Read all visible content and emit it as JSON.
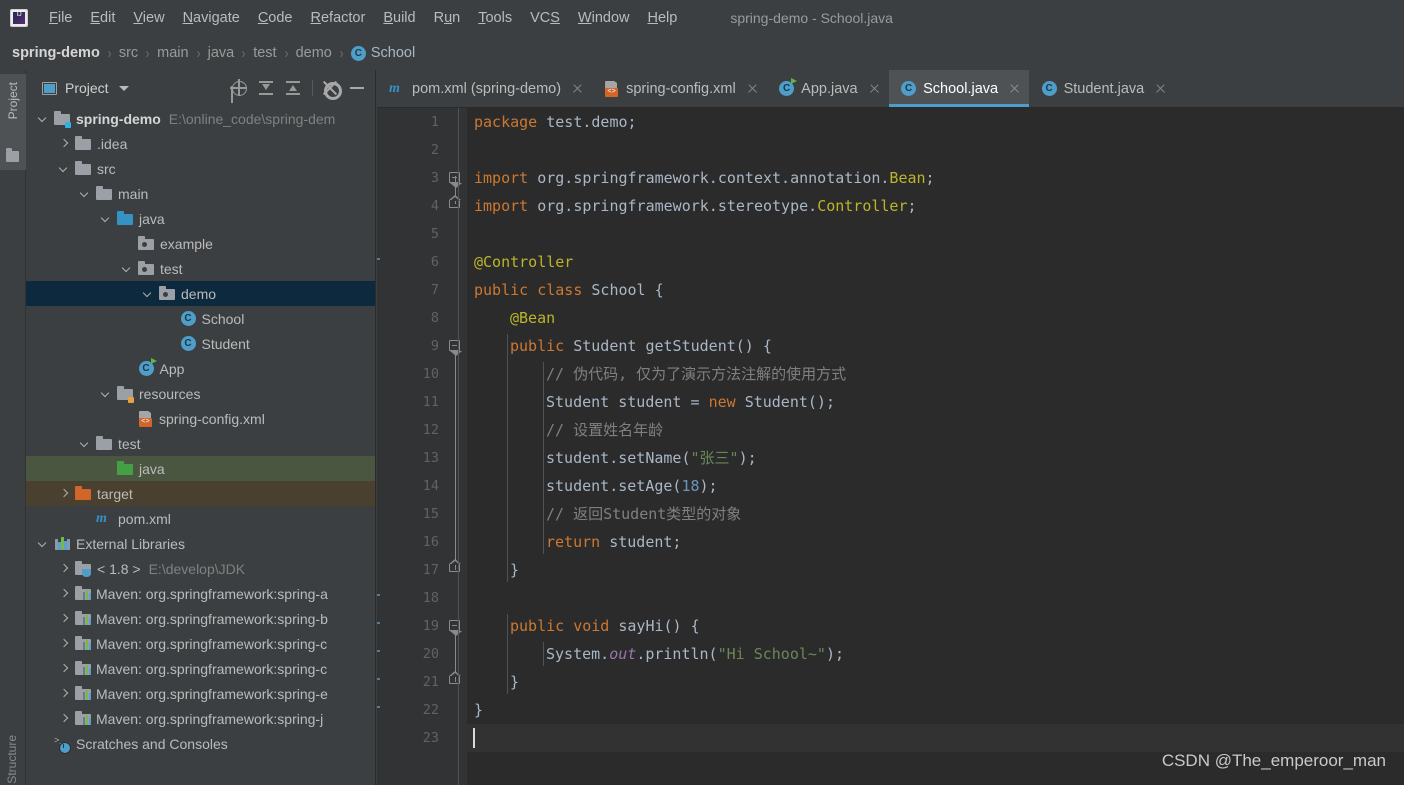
{
  "window": {
    "title": "spring-demo - School.java",
    "logo_icon": "intellij-idea-logo"
  },
  "menu": {
    "items": [
      {
        "label": "File",
        "mnemonic": "F"
      },
      {
        "label": "Edit",
        "mnemonic": "E"
      },
      {
        "label": "View",
        "mnemonic": "V"
      },
      {
        "label": "Navigate",
        "mnemonic": "N"
      },
      {
        "label": "Code",
        "mnemonic": "C"
      },
      {
        "label": "Refactor",
        "mnemonic": "R"
      },
      {
        "label": "Build",
        "mnemonic": "B"
      },
      {
        "label": "Run",
        "mnemonic": "u"
      },
      {
        "label": "Tools",
        "mnemonic": "T"
      },
      {
        "label": "VCS",
        "mnemonic": "S"
      },
      {
        "label": "Window",
        "mnemonic": "W"
      },
      {
        "label": "Help",
        "mnemonic": "H"
      }
    ]
  },
  "breadcrumb": {
    "separator": "›",
    "items": [
      {
        "label": "spring-demo",
        "style": "root"
      },
      {
        "label": "src",
        "style": "dim"
      },
      {
        "label": "main",
        "style": "dim"
      },
      {
        "label": "java",
        "style": "dim"
      },
      {
        "label": "test",
        "style": "dim"
      },
      {
        "label": "demo",
        "style": "dim"
      },
      {
        "label": "School",
        "style": "class",
        "icon": "class-icon",
        "badge": "C"
      }
    ]
  },
  "left_strip": {
    "project_label": "Project",
    "structure_label": "Structure"
  },
  "project_panel": {
    "title": "Project",
    "dropdown_icon": "chevron-down-icon",
    "toolbar": [
      {
        "name": "locate-icon",
        "tooltip": "Select Opened File"
      },
      {
        "name": "expand-all-icon",
        "tooltip": "Expand All"
      },
      {
        "name": "collapse-all-icon",
        "tooltip": "Collapse All"
      },
      {
        "name": "gear-icon",
        "tooltip": "Settings"
      },
      {
        "name": "minimize-icon",
        "tooltip": "Hide"
      }
    ],
    "tree": [
      {
        "label": "spring-demo",
        "path": "E:\\online_code\\spring-dem",
        "indent": 0,
        "arrow": "down",
        "icon": "module-folder",
        "bold": true,
        "state": "normal"
      },
      {
        "label": ".idea",
        "path": "",
        "indent": 1,
        "arrow": "right",
        "icon": "folder-grey",
        "bold": false,
        "state": "normal"
      },
      {
        "label": "src",
        "path": "",
        "indent": 1,
        "arrow": "down",
        "icon": "folder-grey",
        "bold": false,
        "state": "normal"
      },
      {
        "label": "main",
        "path": "",
        "indent": 2,
        "arrow": "down",
        "icon": "folder-grey",
        "bold": false,
        "state": "normal"
      },
      {
        "label": "java",
        "path": "",
        "indent": 3,
        "arrow": "down",
        "icon": "folder-blue",
        "bold": false,
        "state": "normal"
      },
      {
        "label": "example",
        "path": "",
        "indent": 4,
        "arrow": "none",
        "icon": "folder-package",
        "bold": false,
        "state": "normal"
      },
      {
        "label": "test",
        "path": "",
        "indent": 4,
        "arrow": "down",
        "icon": "folder-package",
        "bold": false,
        "state": "normal"
      },
      {
        "label": "demo",
        "path": "",
        "indent": 5,
        "arrow": "down",
        "icon": "folder-package",
        "bold": false,
        "state": "selected"
      },
      {
        "label": "School",
        "path": "",
        "indent": 6,
        "arrow": "none",
        "icon": "class-icon",
        "bold": false,
        "state": "normal"
      },
      {
        "label": "Student",
        "path": "",
        "indent": 6,
        "arrow": "none",
        "icon": "class-icon",
        "bold": false,
        "state": "normal"
      },
      {
        "label": "App",
        "path": "",
        "indent": 4,
        "arrow": "none",
        "icon": "class-runnable-icon",
        "bold": false,
        "state": "normal"
      },
      {
        "label": "resources",
        "path": "",
        "indent": 3,
        "arrow": "down",
        "icon": "folder-resources",
        "bold": false,
        "state": "normal"
      },
      {
        "label": "spring-config.xml",
        "path": "",
        "indent": 4,
        "arrow": "none",
        "icon": "xml-file-icon",
        "bold": false,
        "state": "normal"
      },
      {
        "label": "test",
        "path": "",
        "indent": 2,
        "arrow": "down",
        "icon": "folder-grey",
        "bold": false,
        "state": "normal"
      },
      {
        "label": "java",
        "path": "",
        "indent": 3,
        "arrow": "none",
        "icon": "folder-green",
        "bold": false,
        "state": "highlight-green"
      },
      {
        "label": "target",
        "path": "",
        "indent": 1,
        "arrow": "right",
        "icon": "folder-orange",
        "bold": false,
        "state": "highlight-brown"
      },
      {
        "label": "pom.xml",
        "path": "",
        "indent": 2,
        "arrow": "none",
        "icon": "maven-icon",
        "bold": false,
        "state": "normal"
      },
      {
        "label": "External Libraries",
        "path": "",
        "indent": 0,
        "arrow": "down",
        "icon": "libraries-icon",
        "bold": false,
        "state": "normal"
      },
      {
        "label": "< 1.8 >",
        "path": "E:\\develop\\JDK",
        "indent": 1,
        "arrow": "right",
        "icon": "jdk-icon",
        "bold": false,
        "state": "normal"
      },
      {
        "label": "Maven: org.springframework:spring-a",
        "path": "",
        "indent": 1,
        "arrow": "right",
        "icon": "maven-lib-icon",
        "bold": false,
        "state": "normal"
      },
      {
        "label": "Maven: org.springframework:spring-b",
        "path": "",
        "indent": 1,
        "arrow": "right",
        "icon": "maven-lib-icon",
        "bold": false,
        "state": "normal"
      },
      {
        "label": "Maven: org.springframework:spring-c",
        "path": "",
        "indent": 1,
        "arrow": "right",
        "icon": "maven-lib-icon",
        "bold": false,
        "state": "normal"
      },
      {
        "label": "Maven: org.springframework:spring-c",
        "path": "",
        "indent": 1,
        "arrow": "right",
        "icon": "maven-lib-icon",
        "bold": false,
        "state": "normal"
      },
      {
        "label": "Maven: org.springframework:spring-e",
        "path": "",
        "indent": 1,
        "arrow": "right",
        "icon": "maven-lib-icon",
        "bold": false,
        "state": "normal"
      },
      {
        "label": "Maven: org.springframework:spring-j",
        "path": "",
        "indent": 1,
        "arrow": "right",
        "icon": "maven-lib-icon",
        "bold": false,
        "state": "normal"
      },
      {
        "label": "Scratches and Consoles",
        "path": "",
        "indent": 0,
        "arrow": "none",
        "icon": "scratches-icon",
        "bold": false,
        "state": "normal"
      }
    ]
  },
  "editor": {
    "tabs": [
      {
        "label": "pom.xml (spring-demo)",
        "icon": "maven-icon",
        "active": false
      },
      {
        "label": "spring-config.xml",
        "icon": "xml-file-icon",
        "active": false
      },
      {
        "label": "App.java",
        "icon": "class-runnable-icon",
        "active": false
      },
      {
        "label": "School.java",
        "icon": "class-icon",
        "active": true
      },
      {
        "label": "Student.java",
        "icon": "class-icon",
        "active": false
      }
    ],
    "active_tab": "School.java",
    "caret_line": 23,
    "line_numbers": [
      1,
      2,
      3,
      4,
      5,
      6,
      7,
      8,
      9,
      10,
      11,
      12,
      13,
      14,
      15,
      16,
      17,
      18,
      19,
      20,
      21,
      22,
      23
    ],
    "code_lines": [
      {
        "n": 1,
        "indent": 0,
        "tokens": [
          {
            "t": "package ",
            "c": "kw"
          },
          {
            "t": "test.demo;",
            "c": "pun"
          }
        ]
      },
      {
        "n": 2,
        "indent": 0,
        "tokens": []
      },
      {
        "n": 3,
        "indent": 0,
        "tokens": [
          {
            "t": "import ",
            "c": "kw"
          },
          {
            "t": "org.springframework.context.annotation.",
            "c": "pun"
          },
          {
            "t": "Bean",
            "c": "ann"
          },
          {
            "t": ";",
            "c": "pun"
          }
        ]
      },
      {
        "n": 4,
        "indent": 0,
        "tokens": [
          {
            "t": "import ",
            "c": "kw"
          },
          {
            "t": "org.springframework.stereotype.",
            "c": "pun"
          },
          {
            "t": "Controller",
            "c": "ann"
          },
          {
            "t": ";",
            "c": "pun"
          }
        ]
      },
      {
        "n": 5,
        "indent": 0,
        "tokens": []
      },
      {
        "n": 6,
        "indent": 0,
        "tokens": [
          {
            "t": "@Controller",
            "c": "ann"
          }
        ]
      },
      {
        "n": 7,
        "indent": 0,
        "tokens": [
          {
            "t": "public class ",
            "c": "kw"
          },
          {
            "t": "School",
            "c": "cls"
          },
          {
            "t": " {",
            "c": "pun"
          }
        ]
      },
      {
        "n": 8,
        "indent": 1,
        "tokens": [
          {
            "t": "@Bean",
            "c": "ann"
          }
        ]
      },
      {
        "n": 9,
        "indent": 1,
        "tokens": [
          {
            "t": "public ",
            "c": "kw"
          },
          {
            "t": "Student",
            "c": "typ"
          },
          {
            "t": " ",
            "c": "pun"
          },
          {
            "t": "getStudent",
            "c": "dim"
          },
          {
            "t": "() {",
            "c": "pun"
          }
        ]
      },
      {
        "n": 10,
        "indent": 2,
        "tokens": [
          {
            "t": "// 伪代码, 仅为了演示方法注解的使用方式",
            "c": "cmt"
          }
        ]
      },
      {
        "n": 11,
        "indent": 2,
        "tokens": [
          {
            "t": "Student",
            "c": "typ"
          },
          {
            "t": " student = ",
            "c": "pun"
          },
          {
            "t": "new ",
            "c": "kw"
          },
          {
            "t": "Student();",
            "c": "pun"
          }
        ]
      },
      {
        "n": 12,
        "indent": 2,
        "tokens": [
          {
            "t": "// 设置姓名年龄",
            "c": "cmt"
          }
        ]
      },
      {
        "n": 13,
        "indent": 2,
        "tokens": [
          {
            "t": "student.setName(",
            "c": "pun"
          },
          {
            "t": "\"张三\"",
            "c": "str"
          },
          {
            "t": ");",
            "c": "pun"
          }
        ]
      },
      {
        "n": 14,
        "indent": 2,
        "tokens": [
          {
            "t": "student.setAge(",
            "c": "pun"
          },
          {
            "t": "18",
            "c": "num"
          },
          {
            "t": ");",
            "c": "pun"
          }
        ]
      },
      {
        "n": 15,
        "indent": 2,
        "tokens": [
          {
            "t": "// 返回Student类型的对象",
            "c": "cmt"
          }
        ]
      },
      {
        "n": 16,
        "indent": 2,
        "tokens": [
          {
            "t": "return ",
            "c": "kw"
          },
          {
            "t": "student;",
            "c": "pun"
          }
        ]
      },
      {
        "n": 17,
        "indent": 1,
        "tokens": [
          {
            "t": "}",
            "c": "pun"
          }
        ]
      },
      {
        "n": 18,
        "indent": 0,
        "tokens": []
      },
      {
        "n": 19,
        "indent": 1,
        "tokens": [
          {
            "t": "public void ",
            "c": "kw"
          },
          {
            "t": "sayHi",
            "c": "dim"
          },
          {
            "t": "() {",
            "c": "pun"
          }
        ]
      },
      {
        "n": 20,
        "indent": 2,
        "tokens": [
          {
            "t": "System.",
            "c": "pun"
          },
          {
            "t": "out",
            "c": "fld"
          },
          {
            "t": ".println(",
            "c": "pun"
          },
          {
            "t": "\"Hi School~\"",
            "c": "str"
          },
          {
            "t": ");",
            "c": "pun"
          }
        ]
      },
      {
        "n": 21,
        "indent": 1,
        "tokens": [
          {
            "t": "}",
            "c": "pun"
          }
        ]
      },
      {
        "n": 22,
        "indent": 0,
        "tokens": [
          {
            "t": "}",
            "c": "pun"
          }
        ]
      },
      {
        "n": 23,
        "indent": 0,
        "tokens": []
      }
    ]
  },
  "watermark": {
    "text": "CSDN @The_emperoor_man"
  },
  "colors": {
    "accent": "#4e9ec9",
    "panel_bg": "#3c3f41",
    "editor_bg": "#2b2b2b",
    "gutter_bg": "#313335",
    "selection_blue": "#0d293e",
    "highlight_green": "#4b5641",
    "highlight_brown": "#4a402f",
    "keyword": "#cc7832",
    "string": "#6a8759",
    "number": "#6897bb",
    "comment": "#808080",
    "annotation": "#bbb529",
    "field": "#9876aa",
    "default_text": "#a9b7c6"
  }
}
